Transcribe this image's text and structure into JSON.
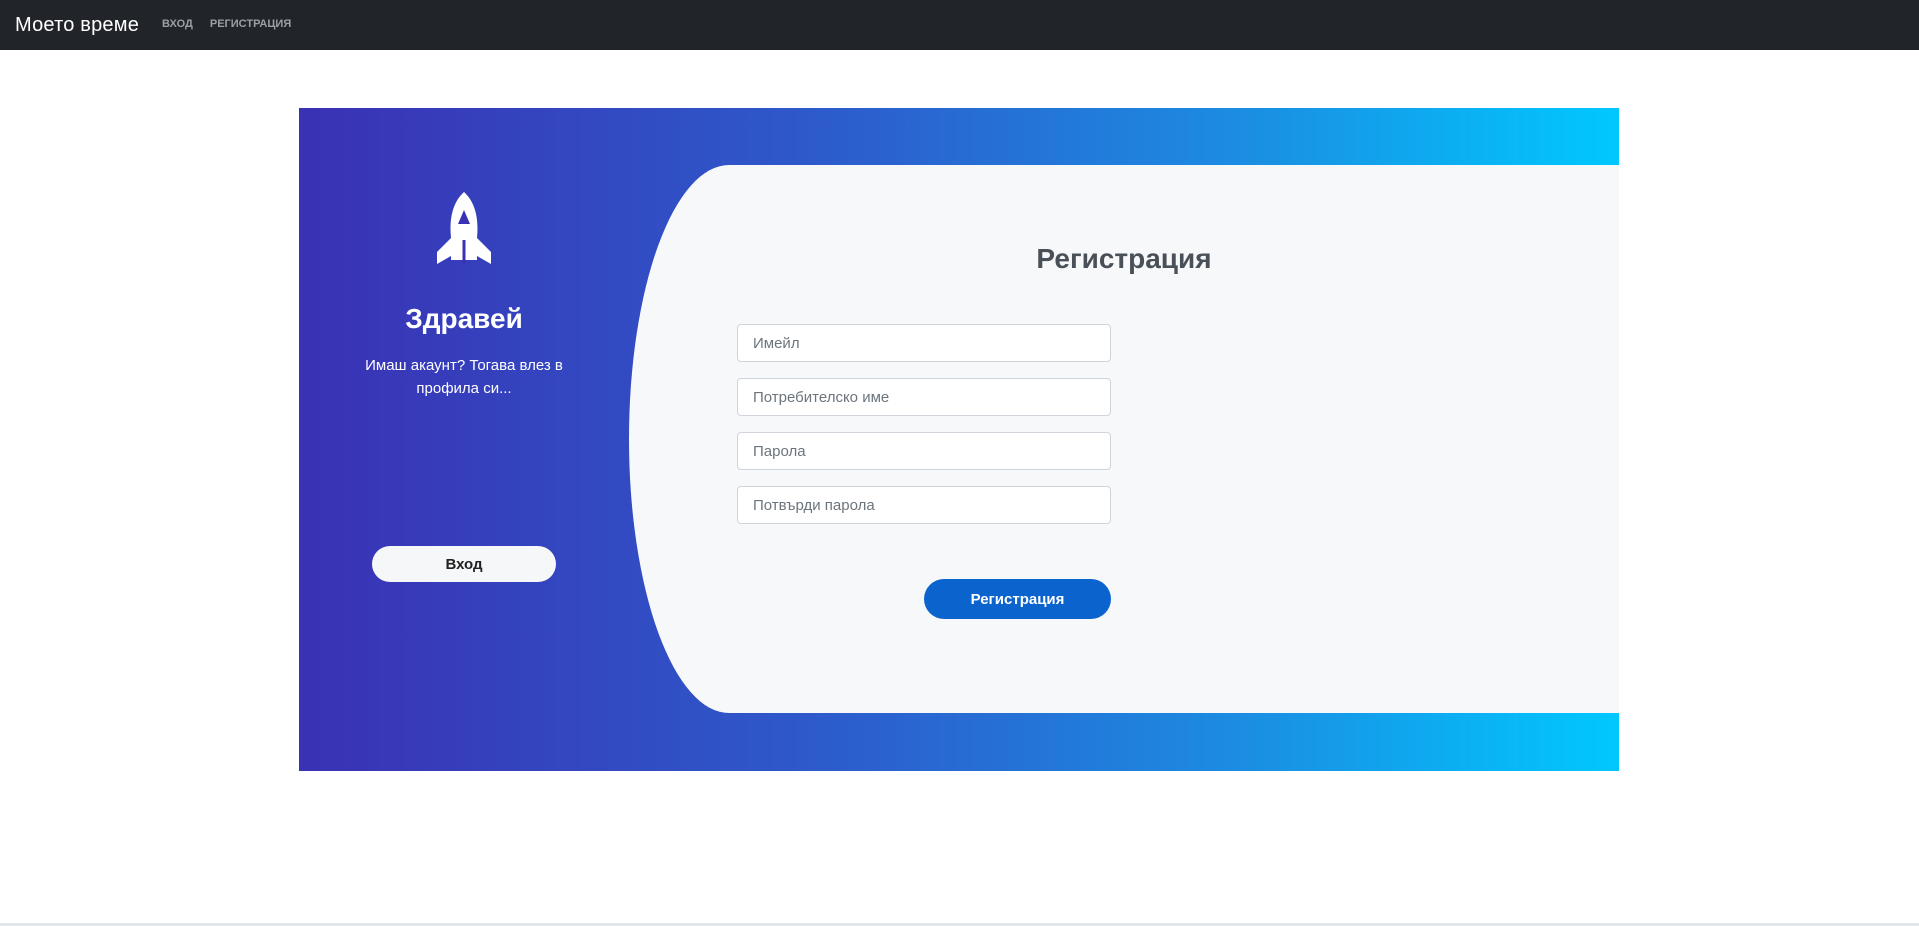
{
  "navbar": {
    "brand": "Моето време",
    "links": [
      "Вход",
      "Регистрация"
    ]
  },
  "left_panel": {
    "icon": "rocket-icon",
    "title": "Здравей",
    "subtitle": "Имаш акаунт? Тогава влез в профила си...",
    "login_label": "Вход"
  },
  "form": {
    "title": "Регистрация",
    "fields": [
      {
        "placeholder": "Имейл",
        "value": ""
      },
      {
        "placeholder": "Потребителско име",
        "value": ""
      },
      {
        "placeholder": "Парола",
        "value": ""
      },
      {
        "placeholder": "Потвърди парола",
        "value": ""
      }
    ],
    "submit_label": "Регистрация"
  },
  "colors": {
    "navbar": "#212529",
    "gradient_start": "#3a31b4",
    "gradient_end": "#00c8ff",
    "primary_button": "#0b63ce",
    "form_background": "#f7f8fa"
  }
}
